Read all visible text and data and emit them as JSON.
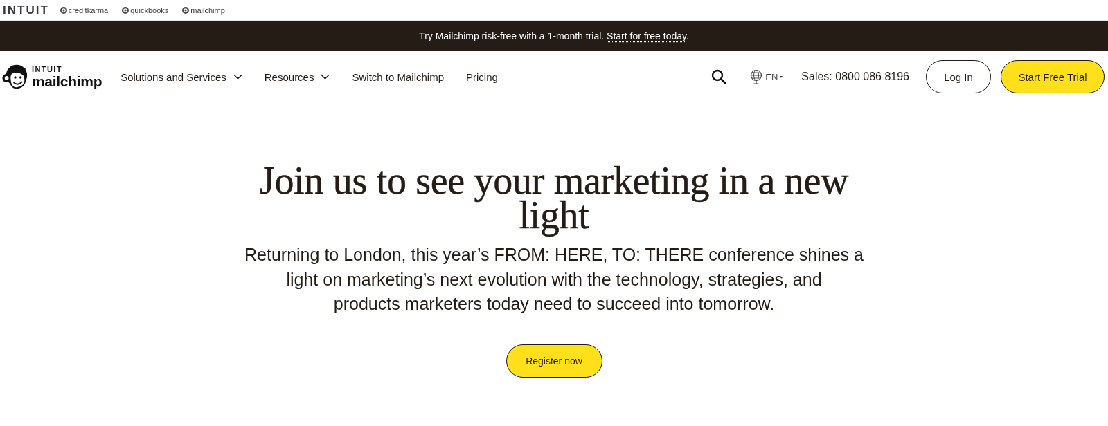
{
  "brand_bar": {
    "logo": "INTUIT",
    "brands": [
      "creditkarma",
      "quickbooks",
      "mailchimp"
    ]
  },
  "promo_banner": {
    "text": "Try Mailchimp risk-free with a 1-month trial.",
    "link": "Start for free today",
    "after_link": "."
  },
  "nav": {
    "logo": {
      "top": "INTUIT",
      "bottom": "mailchimp"
    },
    "items": [
      {
        "label": "Solutions and Services",
        "dropdown": true
      },
      {
        "label": "Resources",
        "dropdown": true
      },
      {
        "label": "Switch to Mailchimp",
        "dropdown": false
      },
      {
        "label": "Pricing",
        "dropdown": false
      }
    ],
    "language": "EN",
    "sales": "Sales: 0800 086 8196",
    "buttons": [
      {
        "label": "Log In",
        "kind": "outline"
      },
      {
        "label": "Start Free Trial",
        "kind": "primary"
      }
    ]
  },
  "hero": {
    "title": "Join us to see your marketing in a new light",
    "text_lines": [
      "Returning to London, this year’s FROM: HERE, TO: THERE conference shines a",
      "light on marketing’s next evolution with the technology, strategies, and",
      "products marketers today need to succeed into tomorrow."
    ],
    "button": "Register now"
  }
}
